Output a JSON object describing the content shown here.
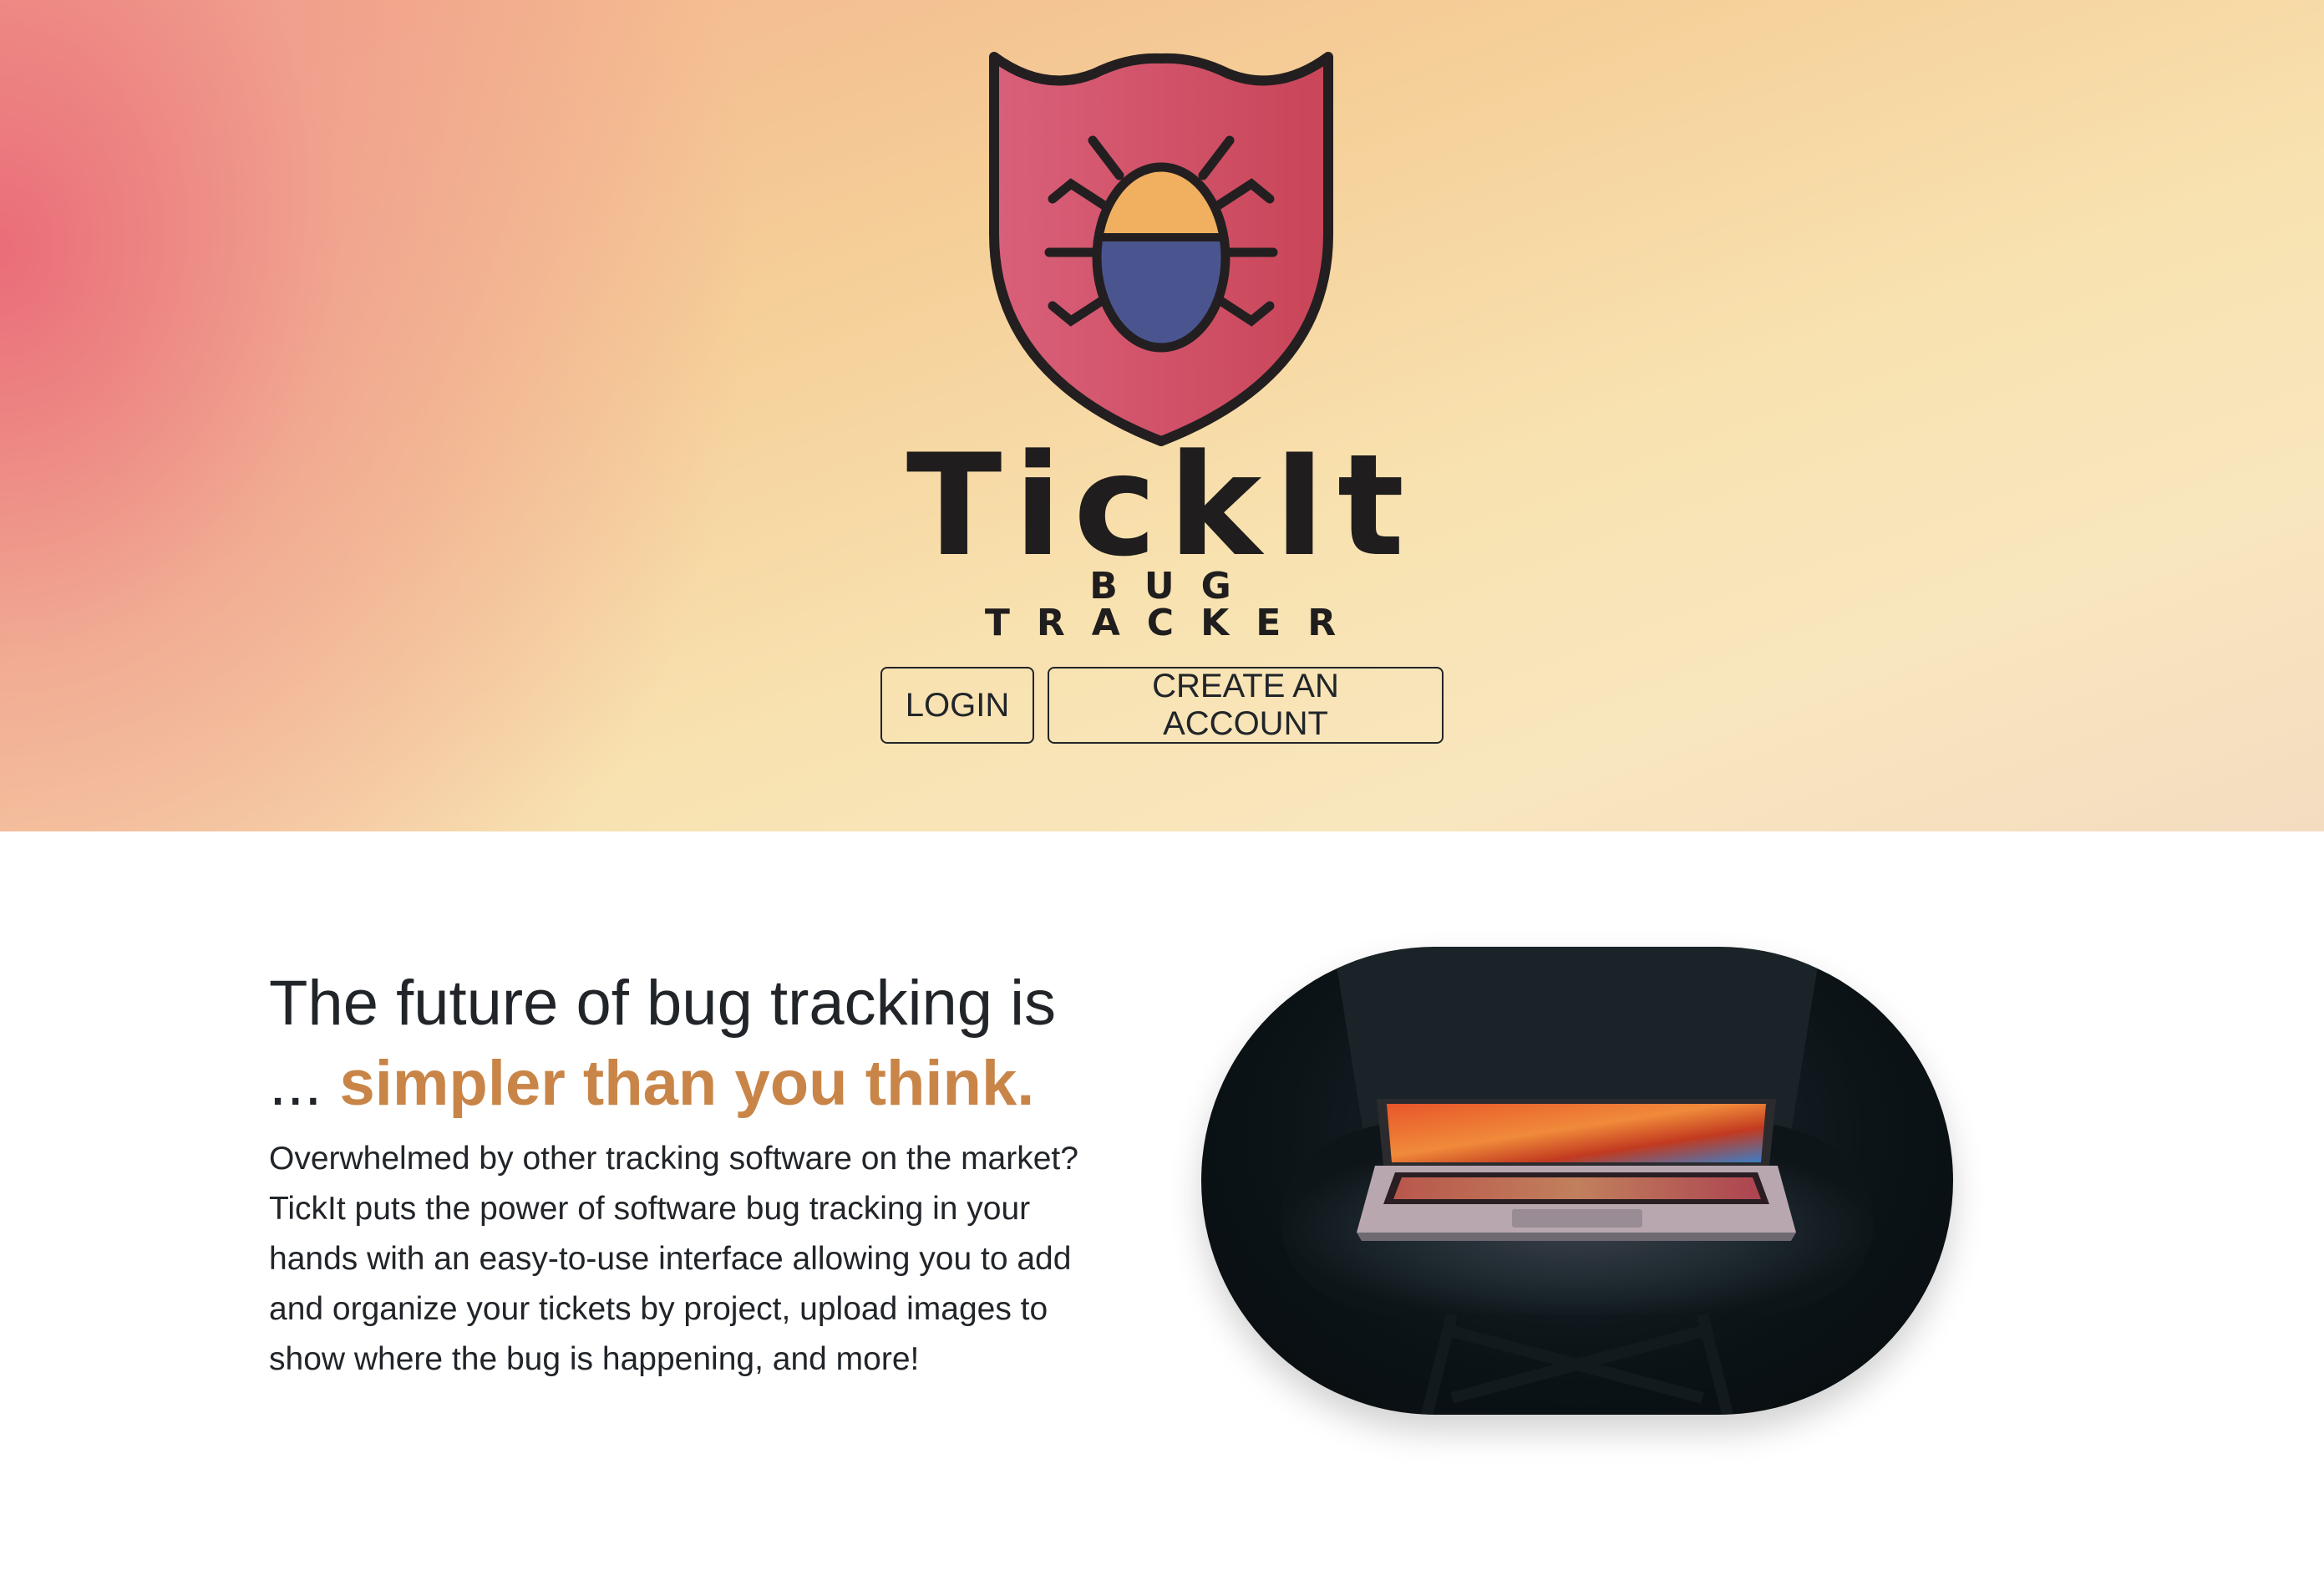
{
  "brand": {
    "name": "TickIt",
    "tagline": "BUG TRACKER",
    "colors": {
      "shield": "#d35a6f",
      "bug_top": "#f0b060",
      "bug_bottom": "#4a5590",
      "outline": "#231f20",
      "accent": "#c98547"
    }
  },
  "hero": {
    "buttons": {
      "login": "LOGIN",
      "create_account": "CREATE AN ACCOUNT"
    }
  },
  "feature": {
    "headline_line1": "The future of bug tracking is",
    "headline_prefix": "... ",
    "headline_accent": "simpler than you think.",
    "body": "Overwhelmed by other tracking software on the market? TickIt puts the power of software bug tracking in your hands with an easy-to-use interface allowing you to add and organize your tickets by project, upload images to show where the bug is happening, and more!",
    "image_subject": "laptop-on-chair-photo"
  }
}
